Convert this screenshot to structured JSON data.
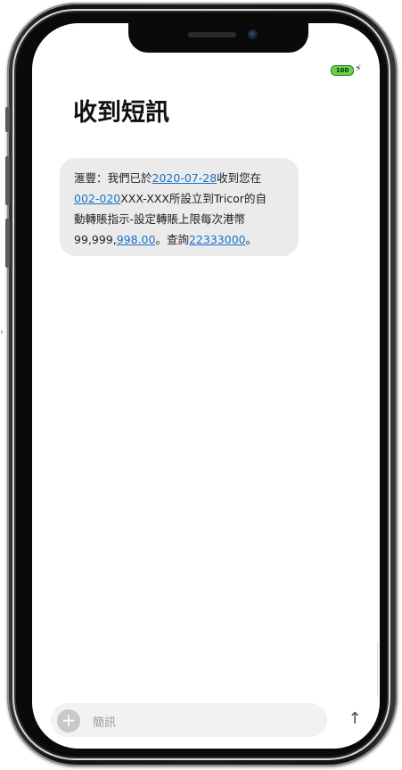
{
  "status_bar": {
    "battery_level": "100",
    "charging_icon": "⚡"
  },
  "header": {
    "title": "收到短訊"
  },
  "message": {
    "line1_prefix": "滙豐：我們已於",
    "line1_link_date": "2020-07-28",
    "line1_suffix": "收到您在",
    "line2_link_account": "002-020",
    "line2_suffix": "XXX-XXX所設立到Tricor的自",
    "line3_text": "動轉賬指示-設定轉賬上限每次港幣",
    "line4_prefix": "99,999,",
    "line4_link_amount": "998.00",
    "line4_middle": "。查詢",
    "line4_link_phone": "22333000",
    "line4_suffix": "。"
  },
  "composer": {
    "add_icon": "+",
    "placeholder": "簡訊",
    "send_icon": "↑"
  },
  "colors": {
    "bubble_bg": "#ebebeb",
    "link": "#1a73c9",
    "battery": "#6bd14d"
  }
}
